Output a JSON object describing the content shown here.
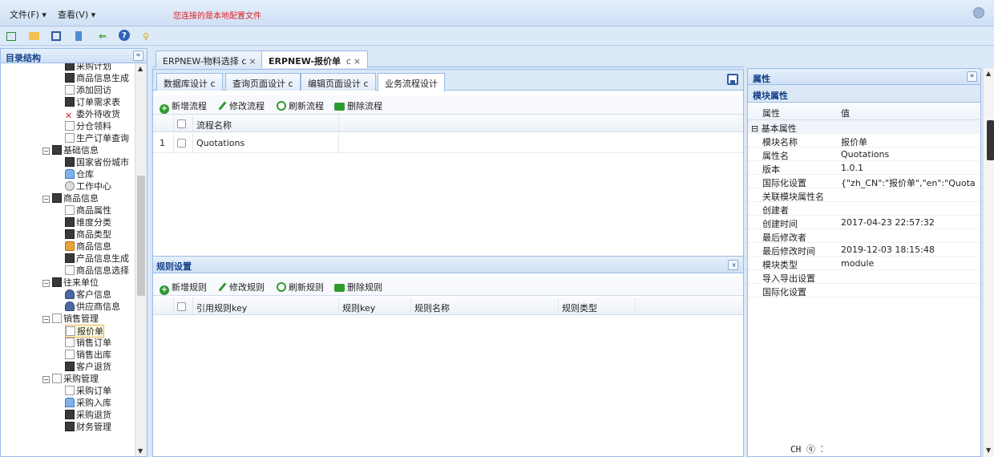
{
  "menubar": {
    "file": "文件(F) ▾",
    "view": "查看(V) ▾",
    "warning": "您连接的是本地配置文件"
  },
  "toolbar": {
    "icons": [
      "new-icon",
      "open-folder-icon",
      "save-icon",
      "export-icon",
      "share-icon",
      "help-icon",
      "lightbulb-icon"
    ]
  },
  "left_panel": {
    "title": "目录结构",
    "collapse": "«",
    "tree": [
      {
        "label": "采购计划",
        "indent": 3,
        "icon": "dark"
      },
      {
        "label": "商品信息生成",
        "indent": 3,
        "icon": "dark"
      },
      {
        "label": "添加回访",
        "indent": 3,
        "icon": "file"
      },
      {
        "label": "订单需求表",
        "indent": 3,
        "icon": "dark"
      },
      {
        "label": "委外待收货",
        "indent": 3,
        "icon": "cross"
      },
      {
        "label": "分仓领料",
        "indent": 3,
        "icon": "file"
      },
      {
        "label": "生产订单查询",
        "indent": 3,
        "icon": "file"
      },
      {
        "label": "基础信息",
        "indent": 1,
        "icon": "dark",
        "exp": "−"
      },
      {
        "label": "国家省份城市",
        "indent": 3,
        "icon": "dark"
      },
      {
        "label": "仓库",
        "indent": 3,
        "icon": "house"
      },
      {
        "label": "工作中心",
        "indent": 3,
        "icon": "gear"
      },
      {
        "label": "商品信息",
        "indent": 1,
        "icon": "dark",
        "exp": "−"
      },
      {
        "label": "商品属性",
        "indent": 3,
        "icon": "file"
      },
      {
        "label": "维度分类",
        "indent": 3,
        "icon": "dark"
      },
      {
        "label": "商品类型",
        "indent": 3,
        "icon": "dark"
      },
      {
        "label": "商品信息",
        "indent": 3,
        "icon": "cube"
      },
      {
        "label": "产品信息生成",
        "indent": 3,
        "icon": "dark"
      },
      {
        "label": "商品信息选择",
        "indent": 3,
        "icon": "file"
      },
      {
        "label": "往来单位",
        "indent": 1,
        "icon": "dark",
        "exp": "−"
      },
      {
        "label": "客户信息",
        "indent": 3,
        "icon": "person"
      },
      {
        "label": "供应商信息",
        "indent": 3,
        "icon": "person"
      },
      {
        "label": "销售管理",
        "indent": 1,
        "icon": "file",
        "exp": "−"
      },
      {
        "label": "报价单",
        "indent": 3,
        "icon": "file",
        "selected": true
      },
      {
        "label": "销售订单",
        "indent": 3,
        "icon": "file"
      },
      {
        "label": "销售出库",
        "indent": 3,
        "icon": "edit"
      },
      {
        "label": "客户退货",
        "indent": 3,
        "icon": "dark"
      },
      {
        "label": "采购管理",
        "indent": 1,
        "icon": "file",
        "exp": "−"
      },
      {
        "label": "采购订单",
        "indent": 3,
        "icon": "file"
      },
      {
        "label": "采购入库",
        "indent": 3,
        "icon": "house"
      },
      {
        "label": "采购退货",
        "indent": 3,
        "icon": "dark"
      },
      {
        "label": "财务管理",
        "indent": 1,
        "icon": "dark"
      }
    ]
  },
  "tabs": [
    {
      "label": "ERPNEW-物料选择",
      "suffix": "c",
      "close": "×"
    },
    {
      "label": "ERPNEW-报价单",
      "suffix": "c",
      "close": "×",
      "active": true
    }
  ],
  "inner_tabs": [
    {
      "label": "数据库设计",
      "suffix": "c"
    },
    {
      "label": "查询页面设计",
      "suffix": "c"
    },
    {
      "label": "编辑页面设计",
      "suffix": "c"
    },
    {
      "label": "业务流程设计",
      "suffix": "",
      "active": true
    }
  ],
  "flow": {
    "actions": [
      "新增流程",
      "修改流程",
      "刷新流程",
      "删除流程"
    ],
    "column": "流程名称",
    "rows": [
      {
        "index": "1",
        "name": "Quotations"
      }
    ]
  },
  "rules": {
    "title": "规则设置",
    "toggle": "»",
    "actions": [
      "新增规则",
      "修改规则",
      "刷新规则",
      "删除规则"
    ],
    "columns": [
      "引用规则key",
      "规则key",
      "规则名称",
      "规则类型"
    ]
  },
  "properties": {
    "title": "属性",
    "expand": "»",
    "section": "模块属性",
    "head_key": "属性",
    "head_val": "值",
    "group": "基本属性",
    "rows": [
      {
        "k": "模块名称",
        "v": "报价单"
      },
      {
        "k": "属性名",
        "v": "Quotations"
      },
      {
        "k": "版本",
        "v": "1.0.1"
      },
      {
        "k": "国际化设置",
        "v": "{\"zh_CN\":\"报价单\",\"en\":\"Quota"
      },
      {
        "k": "关联模块属性名",
        "v": ""
      },
      {
        "k": "创建者",
        "v": ""
      },
      {
        "k": "创建时间",
        "v": "2017-04-23 22:57:32"
      },
      {
        "k": "最后修改者",
        "v": ""
      },
      {
        "k": "最后修改时间",
        "v": "2019-12-03 18:15:48"
      },
      {
        "k": "模块类型",
        "v": "module"
      },
      {
        "k": "导入导出设置",
        "v": ""
      },
      {
        "k": "国际化设置",
        "v": ""
      }
    ]
  },
  "ime": "CH ⓠ ⁚",
  "colors": {
    "accent": "#15428b",
    "border": "#99bbe8",
    "green": "#2e9a2e",
    "warning": "#e02020"
  }
}
